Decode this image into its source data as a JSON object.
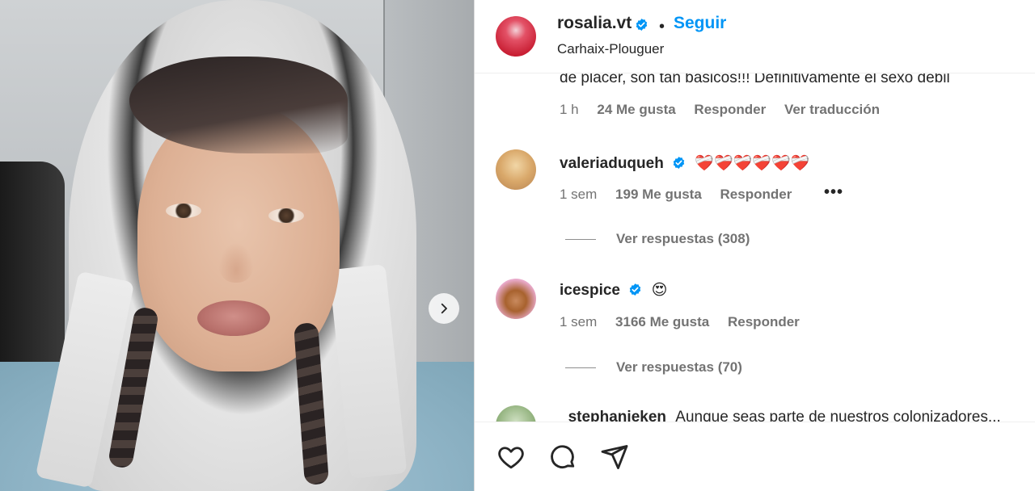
{
  "post": {
    "username": "rosalia.vt",
    "follow_label": "Seguir",
    "separator": "•",
    "location": "Carhaix-Plouguer"
  },
  "comments": {
    "truncated_text": "de placer, son tan basicos!!! Definitivamente el sexo debil",
    "first_meta": {
      "time": "1 h",
      "likes": "24 Me gusta",
      "reply": "Responder",
      "translate": "Ver traducción"
    },
    "items": [
      {
        "username": "valeriaduqueh",
        "text": "❤️‍🩹❤️‍🩹❤️‍🩹❤️‍🩹❤️‍🩹❤️‍🩹",
        "time": "1 sem",
        "likes": "199 Me gusta",
        "reply": "Responder",
        "more": "•••",
        "view_replies": "Ver respuestas (308)"
      },
      {
        "username": "icespice",
        "text": "😍",
        "time": "1 sem",
        "likes": "3166 Me gusta",
        "reply": "Responder",
        "view_replies": "Ver respuestas (70)"
      },
      {
        "username": "_stephanieken",
        "text": "Aunque seas parte de nuestros colonizadores..."
      }
    ]
  },
  "icons": [
    "verified-icon",
    "chevron-right-icon",
    "heart-icon",
    "comment-icon",
    "share-icon"
  ],
  "colors": {
    "link_blue": "#0095f6",
    "verified_blue": "#0095f6",
    "text": "#262626",
    "muted": "#737373"
  }
}
